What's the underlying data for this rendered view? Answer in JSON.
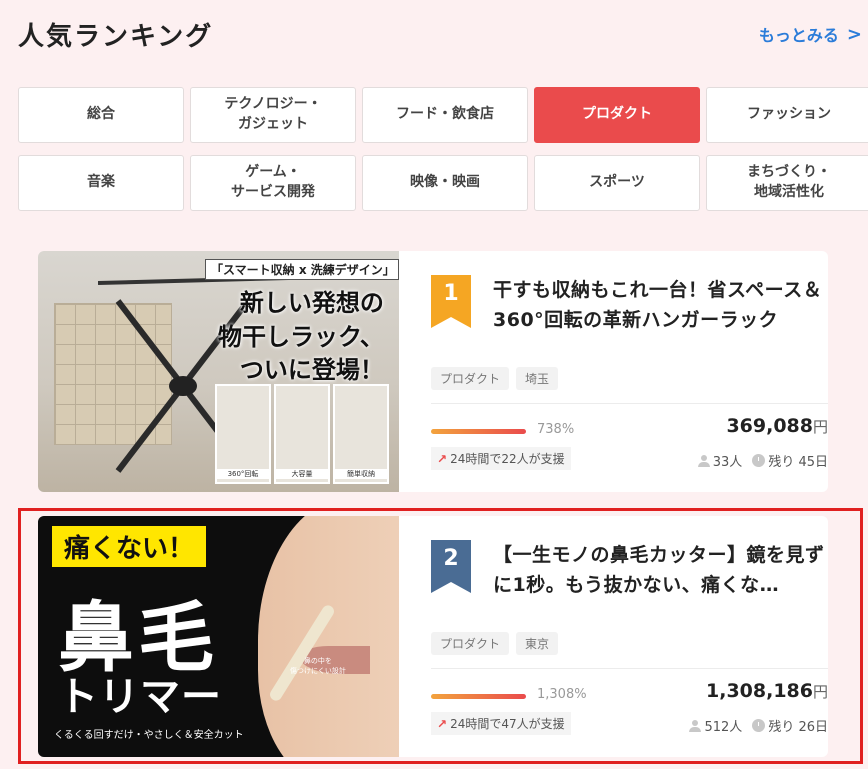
{
  "header": {
    "title": "人気ランキング",
    "more_label": "もっとみる"
  },
  "categories": [
    {
      "label": "総合",
      "active": false
    },
    {
      "label": "テクノロジー・\nガジェット",
      "active": false
    },
    {
      "label": "フード・飲食店",
      "active": false
    },
    {
      "label": "プロダクト",
      "active": true
    },
    {
      "label": "ファッション",
      "active": false
    },
    {
      "label": "音楽",
      "active": false
    },
    {
      "label": "ゲーム・\nサービス開発",
      "active": false
    },
    {
      "label": "映像・映画",
      "active": false
    },
    {
      "label": "スポーツ",
      "active": false
    },
    {
      "label": "まちづくり・\n地域活性化",
      "active": false
    }
  ],
  "projects": [
    {
      "rank": "1",
      "rank_color": "#f5a623",
      "title": "干すも収納もこれ一台！省スペース＆360°回転の革新ハンガーラック",
      "tags": [
        "プロダクト",
        "埼玉"
      ],
      "percent": "738%",
      "amount": "369,088",
      "yen": "円",
      "support": "24時間で22人が支援",
      "backers": "33人",
      "remaining": "残り 45日",
      "image": {
        "tag": "「スマート収納 x 洗練デザイン」",
        "headline": "新しい発想の\n物干しラック、\nついに登場！",
        "labels": [
          "360°回転",
          "大容量",
          "簡単収納"
        ]
      }
    },
    {
      "rank": "2",
      "rank_color": "#4a6c94",
      "title": "【一生モノの鼻毛カッター】鏡を見ずに1秒。もう抜かない、痛くな…",
      "tags": [
        "プロダクト",
        "東京"
      ],
      "percent": "1,308%",
      "amount": "1,308,186",
      "yen": "円",
      "support": "24時間で47人が支援",
      "backers": "512人",
      "remaining": "残り 26日",
      "image": {
        "tag": "痛くない！",
        "headline": "鼻毛",
        "sub": "トリマー",
        "note": "鼻の中を\n傷つけにくい設計",
        "footer": "くるくる回すだけ・やさしく＆安全カット"
      }
    }
  ]
}
